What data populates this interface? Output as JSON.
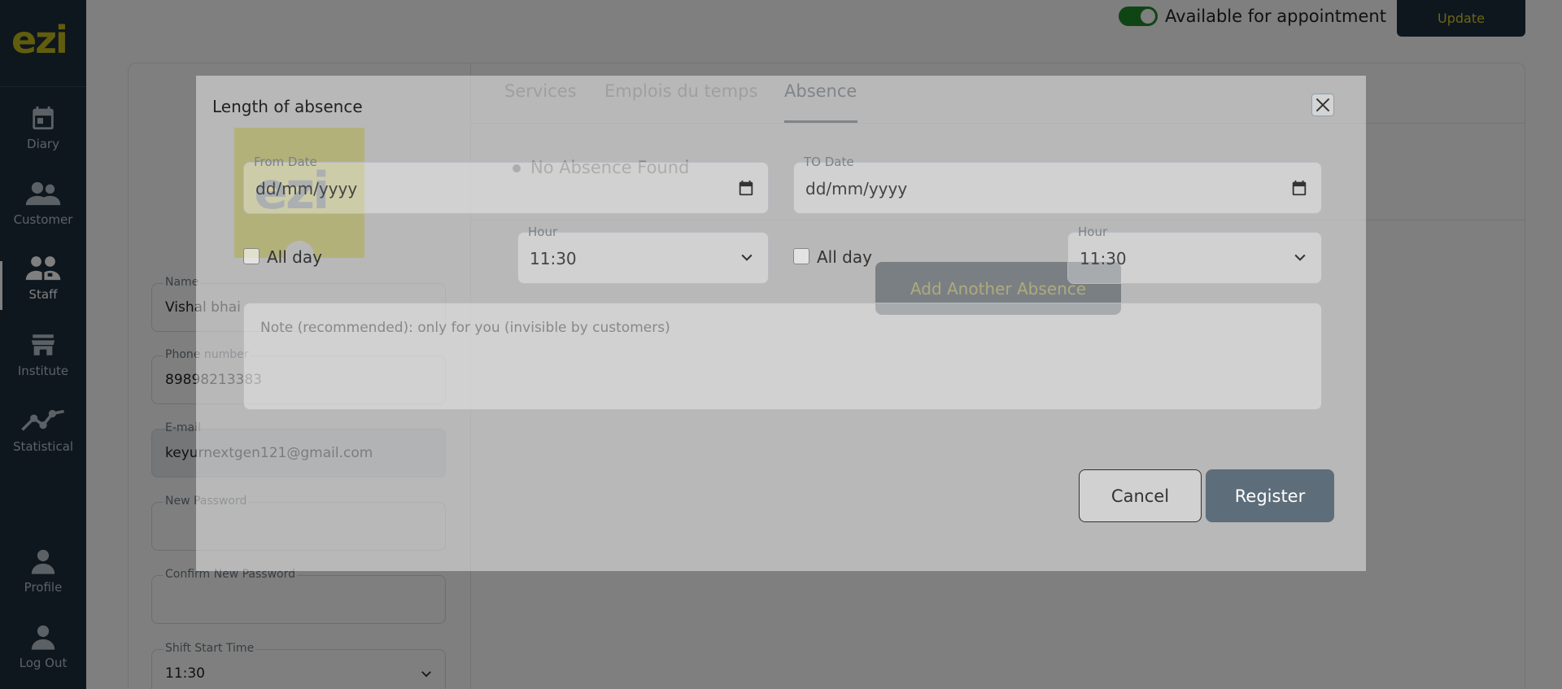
{
  "app": {
    "logo": "ezi"
  },
  "sidebar": {
    "items": [
      {
        "label": "Diary",
        "icon": "calendar-icon"
      },
      {
        "label": "Customer",
        "icon": "users-icon"
      },
      {
        "label": "Staff",
        "icon": "staff-icon",
        "active": true
      },
      {
        "label": "Institute",
        "icon": "store-icon"
      },
      {
        "label": "Statistical",
        "icon": "chart-line-icon"
      }
    ],
    "bottom": [
      {
        "label": "Profile",
        "icon": "user-icon"
      },
      {
        "label": "Log Out",
        "icon": "logout-icon"
      }
    ]
  },
  "topbar": {
    "availability_label": "Available for appointment",
    "availability_on": true,
    "update_label": "Update"
  },
  "tabs": [
    {
      "label": "Services"
    },
    {
      "label": "Emplois du temps"
    },
    {
      "label": "Absence",
      "active": true
    }
  ],
  "absence_panel": {
    "empty_text": "No Absence Found",
    "add_button": "Add Another Absence"
  },
  "avatar": {
    "logo": "ezi"
  },
  "profile_form": {
    "name": {
      "label": "Name",
      "value": "Vishal bhai"
    },
    "phone": {
      "label": "Phone number",
      "value": "89898213383"
    },
    "email": {
      "label": "E-mail",
      "value": "keyurnextgen121@gmail.com"
    },
    "new_password": {
      "label": "New Password",
      "value": ""
    },
    "confirm_password": {
      "label": "Confirm New Password",
      "value": ""
    },
    "shift_start": {
      "label": "Shift Start Time",
      "value": "11:30"
    }
  },
  "modal": {
    "title": "Length of absence",
    "from_date": {
      "label": "From Date",
      "placeholder": "dd/mm/yyyy"
    },
    "to_date": {
      "label": "TO Date",
      "placeholder": "dd/mm/yyyy"
    },
    "from_all_day": "All day",
    "to_all_day": "All day",
    "from_hour": {
      "label": "Hour",
      "value": "11:30"
    },
    "to_hour": {
      "label": "Hour",
      "value": "11:30"
    },
    "note_placeholder": "Note (recommended): only for you (invisible by customers)",
    "cancel_label": "Cancel",
    "register_label": "Register"
  },
  "colors": {
    "sidebar_bg": "#1c2e3c",
    "brand_yellow": "#c5bb1a",
    "toggle_on": "#1f8a2a",
    "register_bg": "#5d6d79"
  }
}
